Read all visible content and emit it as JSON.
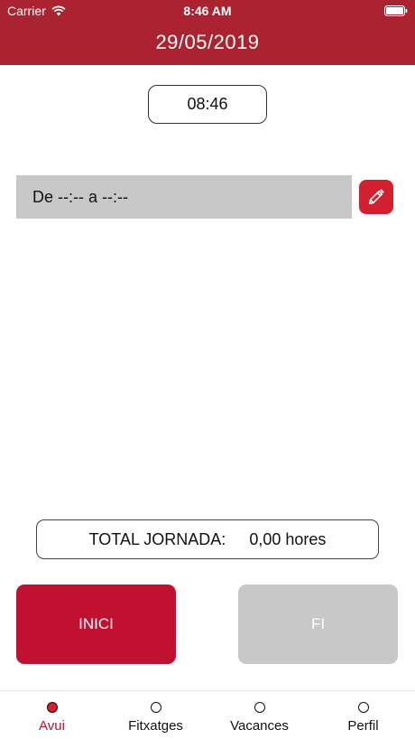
{
  "status_bar": {
    "carrier": "Carrier",
    "time": "8:46 AM",
    "icons": [
      "wifi-icon",
      "battery-icon"
    ]
  },
  "header": {
    "date": "29/05/2019",
    "background_color": "#ab2330"
  },
  "current_time": "08:46",
  "shift": {
    "text": "De --:-- a --:--",
    "edit_icon": "pencil-icon"
  },
  "total": {
    "label": "TOTAL JORNADA:",
    "value": "0,00 hores"
  },
  "buttons": {
    "start_label": "INICI",
    "end_label": "FI",
    "start_color": "#c11130",
    "end_color": "#c8c8c9"
  },
  "tabs": [
    {
      "label": "Avui",
      "active": true
    },
    {
      "label": "Fitxatges",
      "active": false
    },
    {
      "label": "Vacances",
      "active": false
    },
    {
      "label": "Perfil",
      "active": false
    }
  ],
  "accent_color": "#c11130"
}
